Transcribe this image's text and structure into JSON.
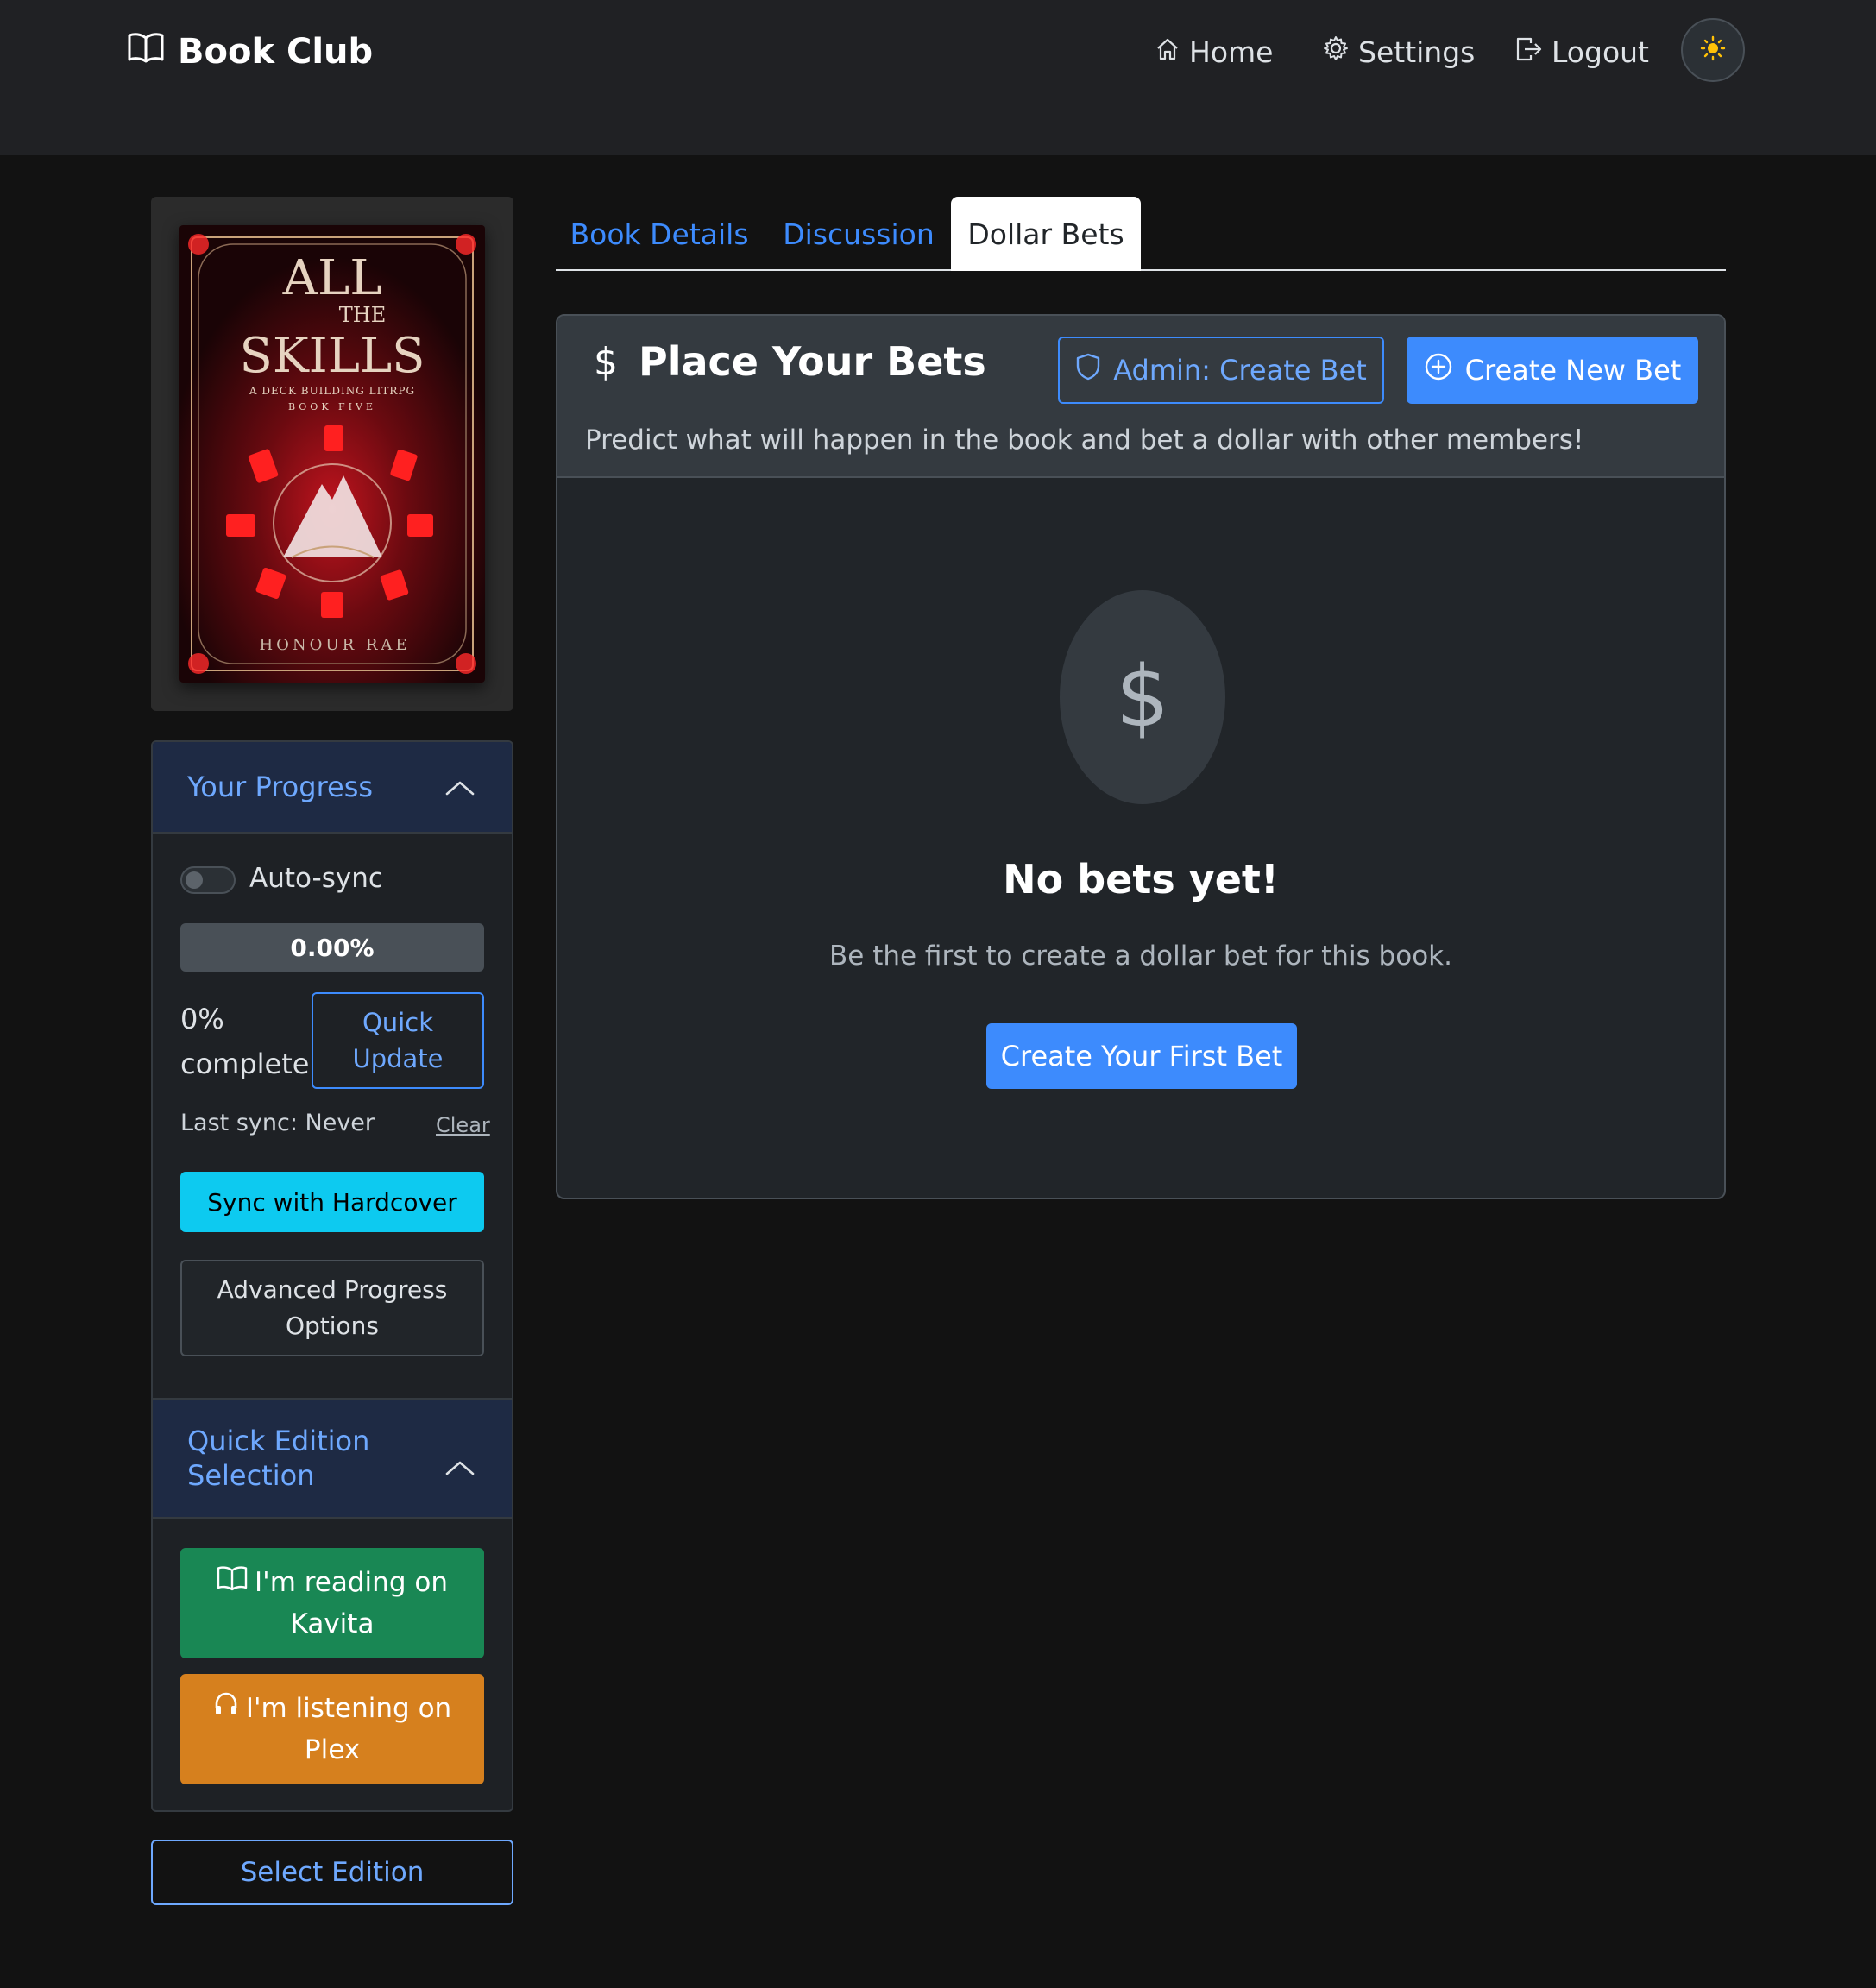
{
  "navbar": {
    "brand": "Book Club",
    "home": "Home",
    "settings": "Settings",
    "logout": "Logout",
    "theme_icon": "sun-icon"
  },
  "book": {
    "cover": {
      "title_line1": "ALL",
      "title_line2": "THE",
      "title_line3": "SKILLS",
      "subtitle1": "A DECK BUILDING LITRPG",
      "subtitle2": "BOOK FIVE",
      "author": "HONOUR RAE"
    }
  },
  "progress": {
    "header": "Your Progress",
    "autosync_label": "Auto-sync",
    "autosync_on": false,
    "percent_label": "0.00%",
    "percent_value": 0,
    "complete_line1": "0%",
    "complete_line2": "complete",
    "quick_update_line1": "Quick",
    "quick_update_line2": "Update",
    "last_sync": "Last sync: Never",
    "clear": "Clear",
    "sync_button": "Sync with Hardcover",
    "advanced_line1": "Advanced Progress",
    "advanced_line2": "Options"
  },
  "edition": {
    "header_line1": "Quick Edition",
    "header_line2": "Selection",
    "kavita_line1": "I'm reading on",
    "kavita_line2": "Kavita",
    "plex_line1": "I'm listening on",
    "plex_line2": "Plex",
    "select_button": "Select Edition"
  },
  "tabs": [
    "Book Details",
    "Discussion",
    "Dollar Bets"
  ],
  "active_tab": "Dollar Bets",
  "bets": {
    "title_icon": "$",
    "title": "Place Your Bets",
    "admin_button": "Admin: Create Bet",
    "create_button": "Create New Bet",
    "description": "Predict what will happen in the book and bet a dollar with other members!",
    "empty_icon": "$",
    "empty_title": "No bets yet!",
    "empty_text": "Be the first to create a dollar bet for this book.",
    "first_button": "Create Your First Bet"
  },
  "colors": {
    "primary": "#3d8bfd",
    "cyan": "#0dcaf0",
    "green": "#198754",
    "orange": "#d6801e",
    "navbar": "#202124",
    "background": "#121212"
  }
}
